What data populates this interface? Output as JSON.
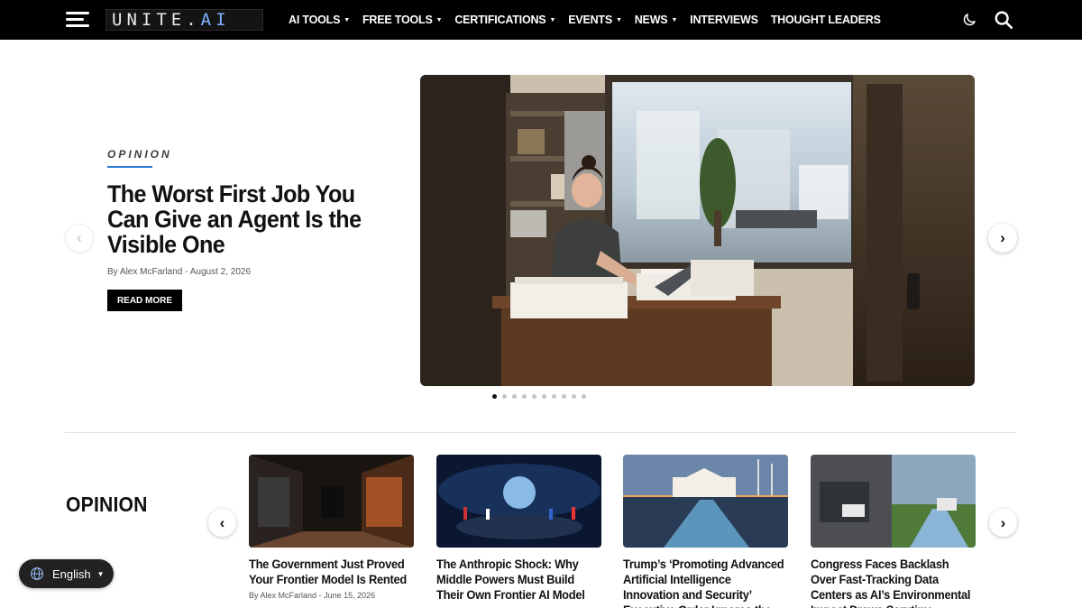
{
  "header": {
    "logo_text": "UNITE.",
    "logo_ai": "AI",
    "nav": [
      {
        "label": "AI TOOLS",
        "caret": true
      },
      {
        "label": "FREE TOOLS",
        "caret": true
      },
      {
        "label": "CERTIFICATIONS",
        "caret": true
      },
      {
        "label": "EVENTS",
        "caret": true
      },
      {
        "label": "NEWS",
        "caret": true
      },
      {
        "label": "INTERVIEWS",
        "caret": false
      },
      {
        "label": "THOUGHT LEADERS",
        "caret": false
      }
    ],
    "icons": [
      "menu-icon",
      "moon-icon",
      "search-icon"
    ]
  },
  "hero": {
    "category": "OPINION",
    "title": "The Worst First Job You Can Give an Agent Is the Visible One",
    "author": "By Alex McFarland",
    "separator": "-",
    "date": "August 2, 2026",
    "button": "READ MORE",
    "prev_arrow": "‹",
    "next_arrow": "›",
    "slide_count": 10,
    "active_slide": 1
  },
  "opinion": {
    "title": "OPINION",
    "prev_arrow": "‹",
    "next_arrow": "›",
    "cards": [
      {
        "title": "The Government Just Proved Your Frontier Model Is Rented",
        "author": "By Alex McFarland",
        "separator": "-",
        "date": "June 15, 2026"
      },
      {
        "title": "The Anthropic Shock: Why Middle Powers Must Build Their Own Frontier AI Model",
        "author": "",
        "separator": "",
        "date": ""
      },
      {
        "title": "Trump’s ‘Promoting Advanced Artificial Intelligence Innovation and Security’ Executive Order Ignores the",
        "author": "",
        "separator": "",
        "date": ""
      },
      {
        "title": "Congress Faces Backlash Over Fast-Tracking Data Centers as AI’s Environmental Impact Draws Scrutiny",
        "author": "",
        "separator": "",
        "date": ""
      }
    ]
  },
  "language": {
    "label": "English",
    "caret": "▼"
  },
  "colors": {
    "accent": "#2b79d6",
    "topbar": "#000000"
  }
}
